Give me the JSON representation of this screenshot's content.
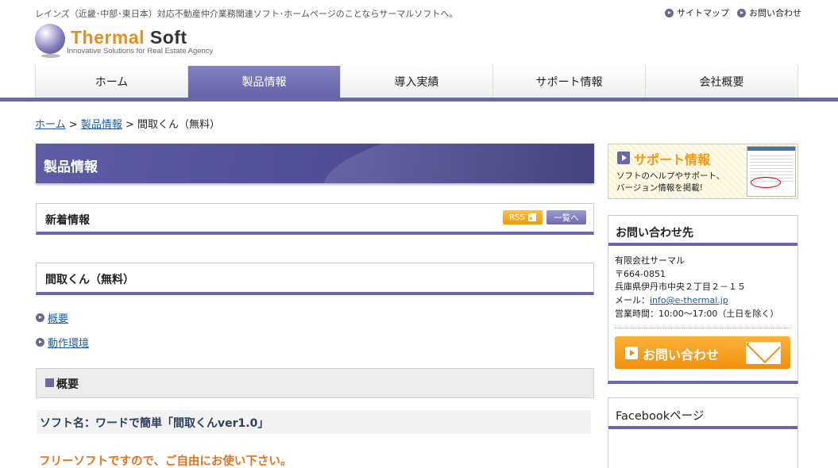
{
  "header": {
    "tagline": "レインズ（近畿･中部･東日本）対応不動産仲介業務関連ソフト･ホームページのことならサーマルソフトへ。",
    "links": [
      "サイトマップ",
      "お問い合わせ"
    ],
    "logo": {
      "word1": "Thermal",
      "word2": "Soft",
      "subtitle": "Innovative Solutions for Real Estate Agency"
    }
  },
  "nav": {
    "items": [
      "ホーム",
      "製品情報",
      "導入実績",
      "サポート情報",
      "会社概要"
    ],
    "active": "製品情報"
  },
  "breadcrumb": {
    "home": "ホーム",
    "sep": ">",
    "products": "製品情報",
    "current": "間取くん（無料）"
  },
  "main": {
    "page_title": "製品情報",
    "news": {
      "title": "新着情報",
      "rss_label": "RSS",
      "list_label": "一覧へ"
    },
    "product_title": "間取くん（無料）",
    "anchors": [
      "概要",
      "動作環境"
    ],
    "section_title": "概要",
    "soft_name": "ソフト名：ワードで簡単「間取くんver1.0」",
    "free_note": "フリーソフトですので、ご自由にお使い下さい。"
  },
  "sidebar": {
    "support_banner": {
      "title": "サポート情報",
      "line1": "ソフトのヘルプやサポート、",
      "line2": "バージョン情報を掲載!"
    },
    "contact": {
      "title": "お問い合わせ先",
      "company": "有限会社サーマル",
      "postal": "〒664-0851",
      "address": "兵庫県伊丹市中央２丁目２－１５",
      "mail_label": "メール：",
      "email": "info@e-thermal.jp",
      "hours": "営業時間：10:00～17:00（土日を除く）",
      "button": "お問い合わせ"
    },
    "facebook_title": "Facebookページ"
  },
  "colors": {
    "accent": "#6a68a8",
    "orange": "#f29a0a",
    "link": "#1e5aa0"
  },
  "icons": [
    "bullet-arrow-icon",
    "rss-icon",
    "play-icon",
    "envelope-icon"
  ]
}
